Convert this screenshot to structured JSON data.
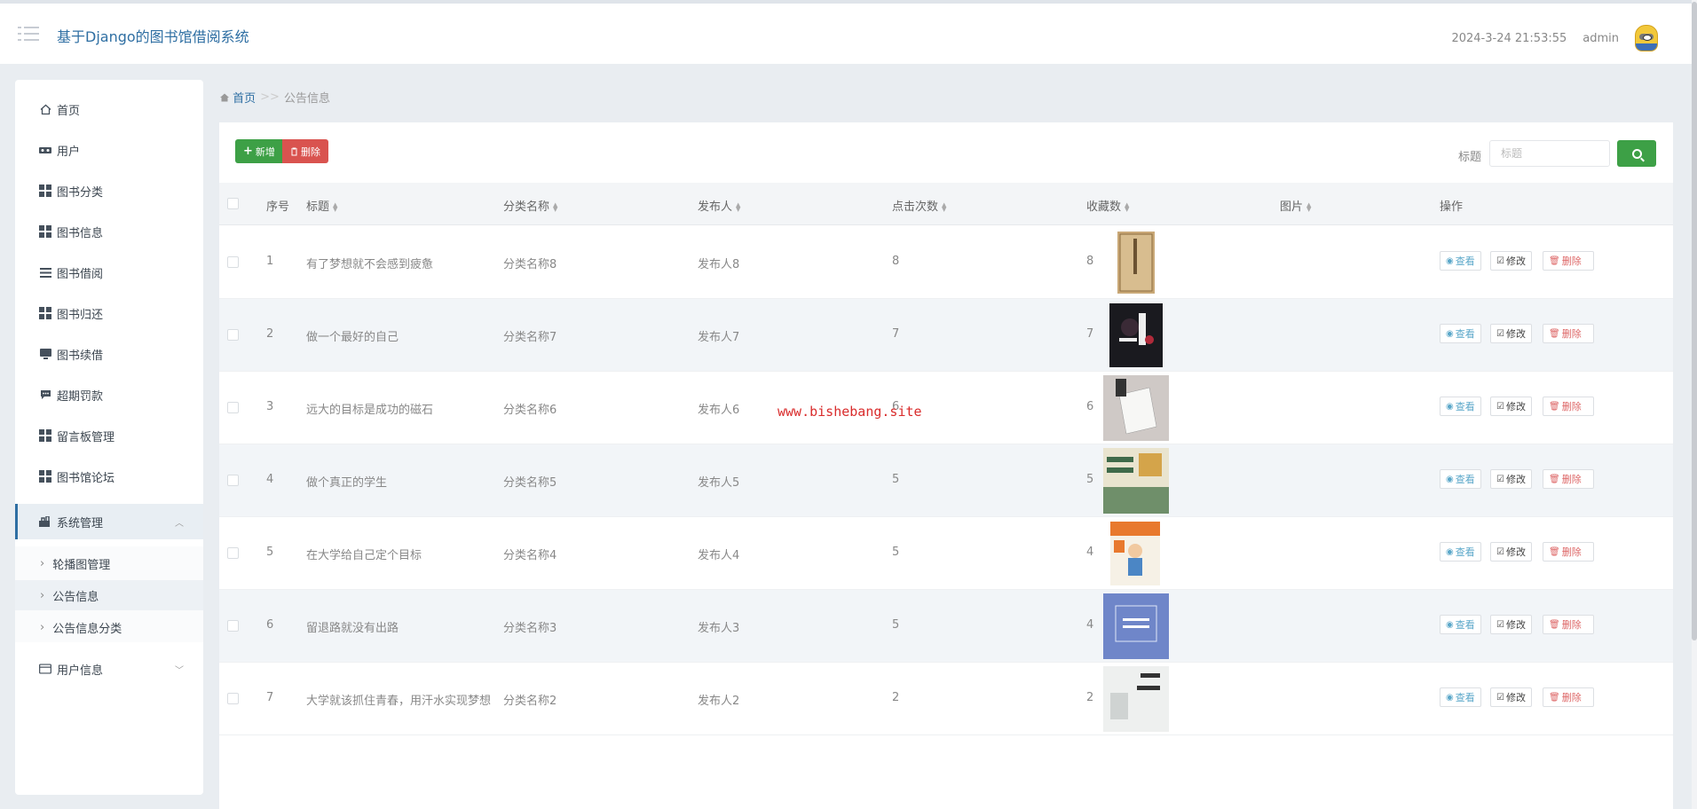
{
  "header": {
    "title": "基于Django的图书馆借阅系统",
    "datetime": "2024-3-24 21:53:55",
    "username": "admin"
  },
  "sidebar": {
    "items": [
      {
        "label": "首页",
        "icon": "home-icon"
      },
      {
        "label": "用户",
        "icon": "users-icon"
      },
      {
        "label": "图书分类",
        "icon": "grid-icon"
      },
      {
        "label": "图书信息",
        "icon": "grid-icon"
      },
      {
        "label": "图书借阅",
        "icon": "list-icon"
      },
      {
        "label": "图书归还",
        "icon": "grid-icon"
      },
      {
        "label": "图书续借",
        "icon": "monitor-icon"
      },
      {
        "label": "超期罚款",
        "icon": "comment-icon"
      },
      {
        "label": "留言板管理",
        "icon": "grid-icon"
      },
      {
        "label": "图书馆论坛",
        "icon": "grid-icon"
      },
      {
        "label": "系统管理",
        "icon": "settings-icon"
      }
    ],
    "sub_items": [
      {
        "label": "轮播图管理"
      },
      {
        "label": "公告信息"
      },
      {
        "label": "公告信息分类"
      }
    ],
    "user_info": {
      "label": "用户信息",
      "icon": "card-icon"
    }
  },
  "breadcrumb": {
    "home": "首页",
    "separator": ">>",
    "current": "公告信息"
  },
  "toolbar": {
    "add_label": "新增",
    "delete_label": "删除",
    "search_label": "标题",
    "search_placeholder": "标题"
  },
  "table": {
    "headers": [
      "序号",
      "标题",
      "分类名称",
      "发布人",
      "点击次数",
      "收藏数",
      "图片",
      "操作"
    ],
    "rows": [
      {
        "index": "1",
        "title": "有了梦想就不会感到疲惫",
        "category": "分类名称8",
        "publisher": "发布人8",
        "clicks": "8",
        "favorites": "8"
      },
      {
        "index": "2",
        "title": "做一个最好的自己",
        "category": "分类名称7",
        "publisher": "发布人7",
        "clicks": "7",
        "favorites": "7"
      },
      {
        "index": "3",
        "title": "远大的目标是成功的磁石",
        "category": "分类名称6",
        "publisher": "发布人6",
        "clicks": "6",
        "favorites": "6"
      },
      {
        "index": "4",
        "title": "做个真正的学生",
        "category": "分类名称5",
        "publisher": "发布人5",
        "clicks": "5",
        "favorites": "5"
      },
      {
        "index": "5",
        "title": "在大学给自己定个目标",
        "category": "分类名称4",
        "publisher": "发布人4",
        "clicks": "5",
        "favorites": "4"
      },
      {
        "index": "6",
        "title": "留退路就没有出路",
        "category": "分类名称3",
        "publisher": "发布人3",
        "clicks": "5",
        "favorites": "4"
      },
      {
        "index": "7",
        "title": "大学就该抓住青春，用汗水实现梦想",
        "category": "分类名称2",
        "publisher": "发布人2",
        "clicks": "2",
        "favorites": "2"
      }
    ],
    "actions": {
      "view": "查看",
      "edit": "修改",
      "delete": "删除"
    }
  },
  "watermark": "www.bishebang.site",
  "colors": {
    "accent": "#2f6fa3",
    "success": "#3da046",
    "danger": "#d9534f",
    "watermark": "#d92c2c"
  }
}
